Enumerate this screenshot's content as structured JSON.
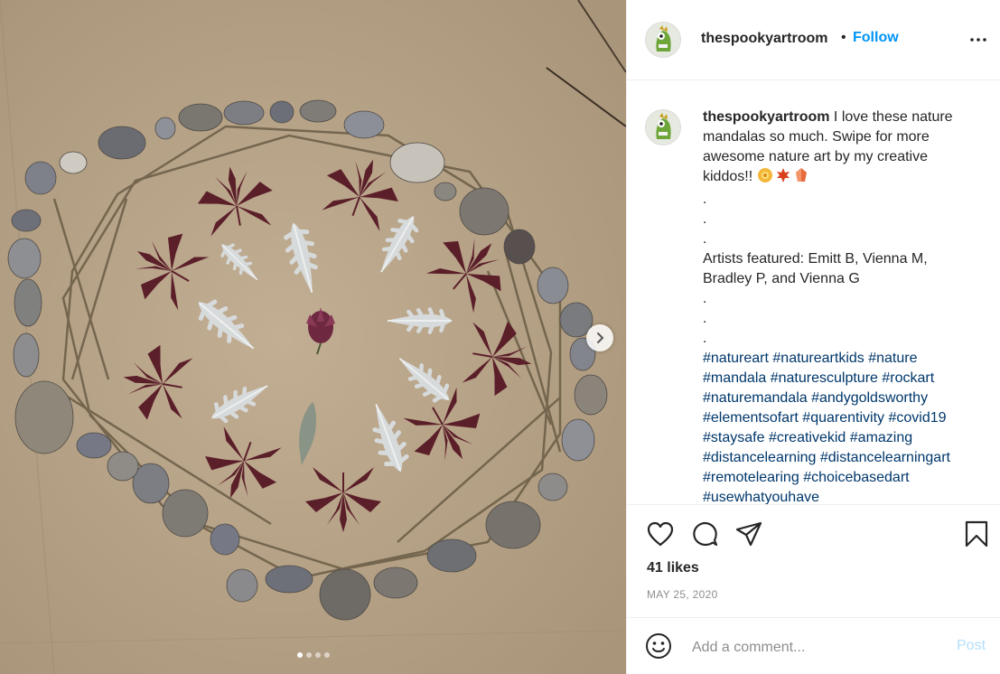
{
  "post": {
    "username": "thespookyartroom",
    "separator": "•",
    "follow_label": "Follow",
    "caption_text": "I love these nature mandalas so much. Swipe for more awesome nature art by my creative kiddos!!",
    "caption_emojis": [
      "blossom",
      "maple-leaf",
      "crystal"
    ],
    "dots_block_1": ".\n.\n.",
    "artists_line": "Artists featured: Emitt B, Vienna M, Bradley P, and Vienna G",
    "dots_block_2": ".\n.\n.",
    "hashtags": [
      "#natureart",
      "#natureartkids",
      "#nature",
      "#mandala",
      "#naturesculpture",
      "#rockart",
      "#naturemandala",
      "#andygoldsworthy",
      "#elementsofart",
      "#quarentivity",
      "#covid19",
      "#staysafe",
      "#creativekid",
      "#amazing",
      "#distancelearning",
      "#distancelearningart",
      "#remotelearing",
      "#choicebasedart",
      "#usewhatyouhave"
    ],
    "likes": "41 likes",
    "date": "MAY 25, 2020"
  },
  "comment": {
    "placeholder": "Add a comment...",
    "post_label": "Post"
  },
  "carousel": {
    "slide_count": 4,
    "active_index": 0
  },
  "colors": {
    "accent": "#0095f6",
    "hashtag": "#00376b",
    "muted": "#8e8e8e",
    "post_disabled": "#b2dffc",
    "cardboard": "#b8a48a"
  },
  "icons": {
    "like": "heart-icon",
    "comment": "comment-icon",
    "share": "share-icon",
    "save": "bookmark-icon",
    "more": "more-icon",
    "emoji": "emoji-icon",
    "next": "chevron-right-icon"
  }
}
